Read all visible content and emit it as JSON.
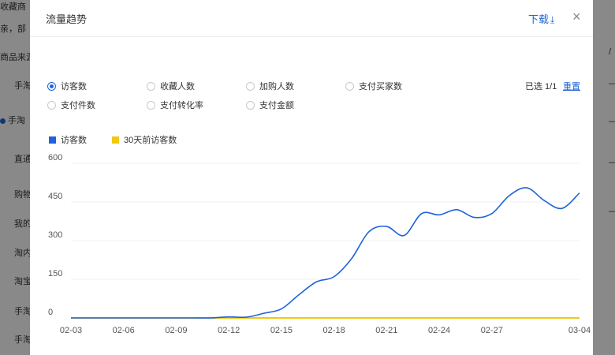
{
  "background": {
    "left_items": [
      "收藏商",
      "亲，部",
      "商品来源",
      "手淘",
      "手淘",
      "直通",
      "购物",
      "我的",
      "淘内",
      "淘宝",
      "手淘",
      "手淘"
    ],
    "right_items": [
      "/",
      "—",
      "—",
      "—",
      "—"
    ]
  },
  "modal": {
    "title": "流量趋势",
    "download_label": "下载",
    "close_label": "×",
    "selected_count": "已选 1/1",
    "reset_label": "重置"
  },
  "metrics": [
    {
      "label": "访客数",
      "checked": true
    },
    {
      "label": "收藏人数",
      "checked": false
    },
    {
      "label": "加购人数",
      "checked": false
    },
    {
      "label": "支付买家数",
      "checked": false
    },
    {
      "label": "支付件数",
      "checked": false
    },
    {
      "label": "支付转化率",
      "checked": false
    },
    {
      "label": "支付金额",
      "checked": false
    }
  ],
  "colors": {
    "accent": "#1f63d8",
    "series_current": "#1f63d8",
    "series_prior": "#f2c811",
    "grid": "#f0f0f0"
  },
  "chart_data": {
    "type": "line",
    "title": "",
    "xlabel": "",
    "ylabel": "",
    "ylim": [
      0,
      600
    ],
    "yticks": [
      0,
      150,
      300,
      450,
      600
    ],
    "xticks": [
      "02-03",
      "02-06",
      "02-09",
      "02-12",
      "02-15",
      "02-18",
      "02-21",
      "02-24",
      "02-27",
      "03-04"
    ],
    "x": [
      "02-03",
      "02-04",
      "02-05",
      "02-06",
      "02-07",
      "02-08",
      "02-09",
      "02-10",
      "02-11",
      "02-12",
      "02-13",
      "02-14",
      "02-15",
      "02-16",
      "02-17",
      "02-18",
      "02-19",
      "02-20",
      "02-21",
      "02-22",
      "02-23",
      "02-24",
      "02-25",
      "02-26",
      "02-27",
      "02-28",
      "03-01",
      "03-02",
      "03-03",
      "03-04"
    ],
    "grid": true,
    "legend_position": "top-left",
    "series": [
      {
        "name": "访客数",
        "values": [
          0,
          0,
          0,
          0,
          0,
          0,
          0,
          0,
          0,
          4,
          3,
          18,
          35,
          90,
          140,
          160,
          230,
          335,
          355,
          320,
          405,
          400,
          420,
          390,
          405,
          475,
          505,
          455,
          425,
          485
        ]
      },
      {
        "name": "30天前访客数",
        "values": [
          0,
          0,
          0,
          0,
          0,
          0,
          0,
          0,
          0,
          0,
          0,
          0,
          0,
          0,
          0,
          0,
          0,
          0,
          0,
          0,
          0,
          0,
          0,
          0,
          0,
          0,
          0,
          0,
          0,
          0
        ]
      }
    ]
  }
}
